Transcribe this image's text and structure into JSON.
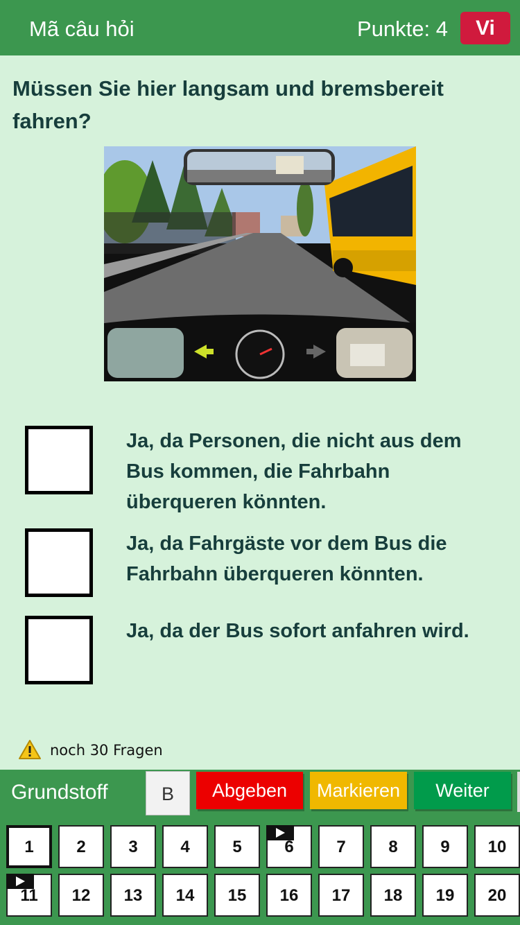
{
  "header": {
    "title": "Mã câu hỏi",
    "score": "Punkte: 4",
    "language": "Vi"
  },
  "question": {
    "text": "Müssen Sie hier langsam und bremsbereit fahren?",
    "image_icon": "traffic-scene-image",
    "answers": [
      {
        "text": "Ja, da Personen, die nicht aus dem Bus kommen, die Fahrbahn überqueren könnten."
      },
      {
        "text": "Ja, da Fahrgäste vor dem Bus die Fahrbahn überqueren könnten."
      },
      {
        "text": "Ja, da der Bus sofort anfahren wird."
      }
    ]
  },
  "remaining": {
    "icon": "warning-icon",
    "text": "noch 30 Fragen"
  },
  "actions": {
    "category": "Grundstoff",
    "class_label": "B",
    "submit": "Abgeben",
    "mark": "Markieren",
    "next": "Weiter"
  },
  "colors": {
    "primary_green": "#3c974f",
    "background": "#d6f2db",
    "submit_red": "#ec0000",
    "mark_yellow": "#f0b800",
    "next_green": "#019b4b",
    "lang_red": "#d01a3d"
  },
  "question_grid": {
    "numbers": [
      "1",
      "2",
      "3",
      "4",
      "5",
      "6",
      "7",
      "8",
      "9",
      "10",
      "11",
      "12",
      "13",
      "14",
      "15",
      "16",
      "17",
      "18",
      "19",
      "20"
    ],
    "active": "1",
    "flagged": [
      "6",
      "11"
    ]
  }
}
